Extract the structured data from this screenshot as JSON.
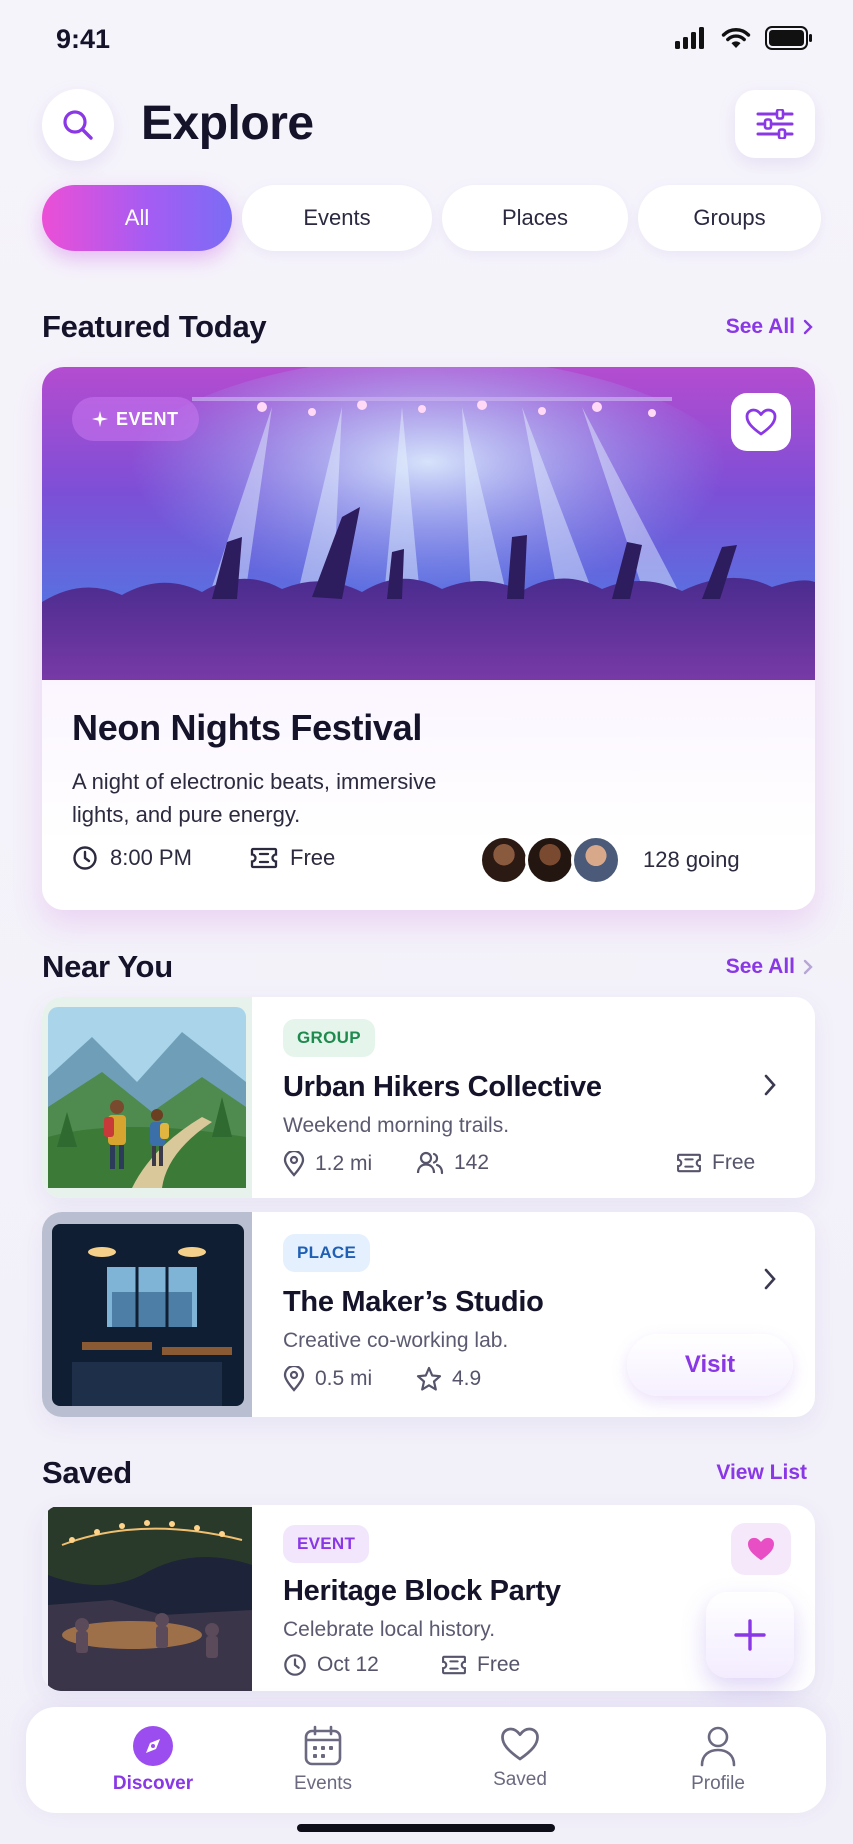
{
  "status": {
    "time": "9:41"
  },
  "header": {
    "title": "Explore"
  },
  "tabs": [
    {
      "label": "All",
      "active": true
    },
    {
      "label": "Events",
      "active": false
    },
    {
      "label": "Places",
      "active": false
    },
    {
      "label": "Groups",
      "active": false
    }
  ],
  "featured": {
    "section_title": "Featured Today",
    "see_all": "See All",
    "badge": "EVENT",
    "title": "Neon Nights Festival",
    "description": "A night of electronic beats, immersive lights, and pure energy.",
    "time": "8:00 PM",
    "price": "Free",
    "going": "128 going"
  },
  "near_you": {
    "section_title": "Near You",
    "see_all": "See All",
    "items": [
      {
        "chip": "GROUP",
        "title": "Urban Hikers Collective",
        "subtitle": "Weekend morning trails.",
        "distance": "1.2 mi",
        "members": "142",
        "price": "Free"
      },
      {
        "chip": "PLACE",
        "title": "The Maker’s Studio",
        "subtitle": "Creative co-working lab.",
        "distance": "0.5 mi",
        "rating": "4.9",
        "action": "Visit"
      }
    ]
  },
  "saved": {
    "section_title": "Saved",
    "view_list": "View List",
    "item": {
      "chip": "EVENT",
      "title": "Heritage Block Party",
      "subtitle": "Celebrate local history.",
      "date": "Oct 12",
      "price": "Free"
    }
  },
  "nav": [
    {
      "label": "Discover",
      "icon": "compass-icon",
      "active": true
    },
    {
      "label": "Events",
      "icon": "calendar-icon",
      "active": false
    },
    {
      "label": "Saved",
      "icon": "heart-icon",
      "active": false
    },
    {
      "label": "Profile",
      "icon": "user-icon",
      "active": false
    }
  ],
  "colors": {
    "accent": "#8a37e6",
    "gradient_start": "#ec4fd6",
    "gradient_end": "#7b6cf5",
    "group_chip_bg": "#e5f5ec",
    "group_chip_text": "#1f8a4d",
    "place_chip_bg": "#e4f0fd",
    "place_chip_text": "#1f5fb5",
    "event_chip_bg": "#f1e6fb",
    "event_chip_text": "#8a37e6"
  }
}
